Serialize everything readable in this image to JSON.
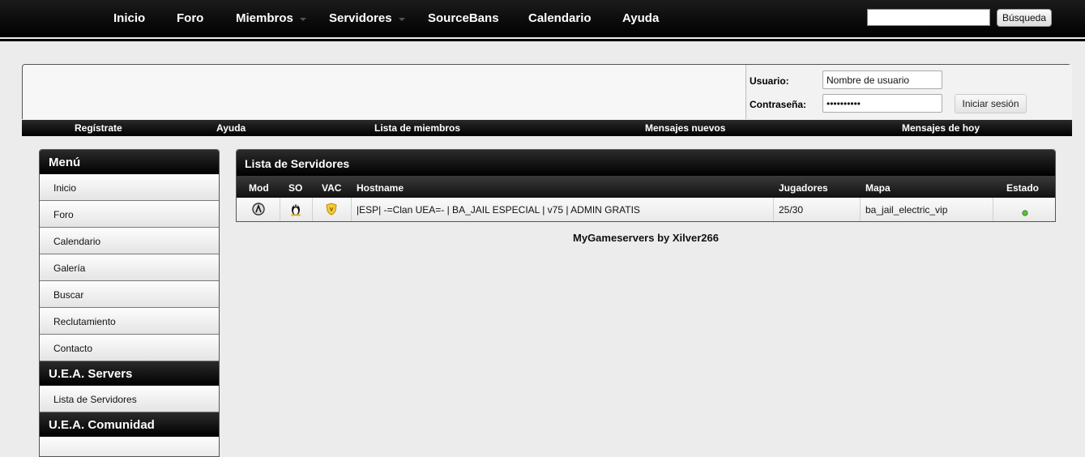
{
  "topnav": {
    "items": [
      "Inicio",
      "Foro",
      "Miembros",
      "Servidores",
      "SourceBans",
      "Calendario",
      "Ayuda"
    ],
    "search_value": "",
    "search_button": "Búsqueda"
  },
  "login": {
    "username_label": "Usuario:",
    "username_value": "Nombre de usuario",
    "password_label": "Contraseña:",
    "password_value": "••••••••••",
    "submit_label": "Iniciar sesión"
  },
  "subnav": {
    "items": [
      "Regístrate",
      "Ayuda",
      "Lista de miembros",
      "Mensajes nuevos",
      "Mensajes de hoy"
    ]
  },
  "sidebar": {
    "menu_title": "Menú",
    "menu_items": [
      "Inicio",
      "Foro",
      "Calendario",
      "Galería",
      "Buscar",
      "Reclutamiento",
      "Contacto"
    ],
    "servers_title": "U.E.A. Servers",
    "servers_items": [
      "Lista de Servidores"
    ],
    "community_title": "U.E.A. Comunidad"
  },
  "server_list": {
    "title": "Lista de Servidores",
    "columns": [
      "Mod",
      "SO",
      "VAC",
      "Hostname",
      "Jugadores",
      "Mapa",
      "Estado"
    ],
    "rows": [
      {
        "mod_icon": "half-life-icon",
        "os_icon": "linux-tux-icon",
        "vac_icon": "vac-shield-icon",
        "hostname": "|ESP| -=Clan UEA=- | BA_JAIL ESPECIAL | v75 | ADMIN GRATIS",
        "players": "25/30",
        "map": "ba_jail_electric_vip",
        "status_icon": "online-dot-icon",
        "status_color": "#5cbf3a"
      }
    ]
  },
  "footer": {
    "credit": "MyGameservers by Xilver266"
  }
}
